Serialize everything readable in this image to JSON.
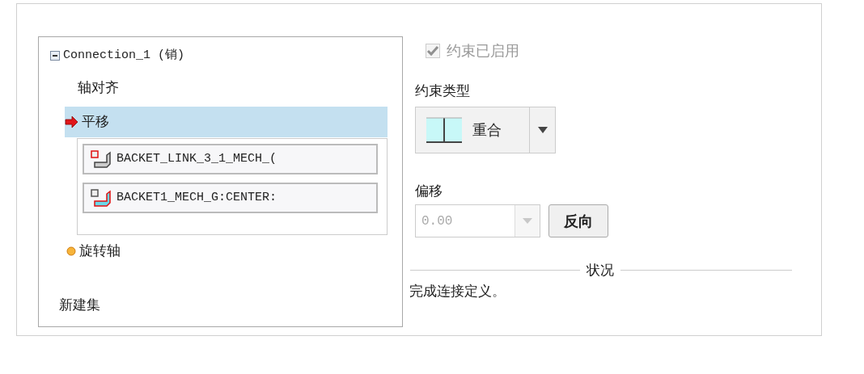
{
  "tree": {
    "label": "Connection_1 (销)",
    "expanded": true,
    "children": [
      {
        "label": "轴对齐",
        "kind": "plain",
        "selected": false
      },
      {
        "label": "平移",
        "kind": "current",
        "selected": true,
        "references": [
          "BACKET_LINK_3_1_MECH_(",
          "BACKET1_MECH_G:CENTER:"
        ]
      },
      {
        "label": "旋转轴",
        "kind": "incomplete",
        "selected": false
      }
    ],
    "new_set": "新建集"
  },
  "constraint_enabled": {
    "label": "约束已启用",
    "checked": true,
    "disabled": true
  },
  "constraint_type": {
    "label": "约束类型",
    "value": "重合"
  },
  "offset": {
    "label": "偏移",
    "value": "0.00",
    "disabled": true
  },
  "flip_button": "反向",
  "status": {
    "title": "状况",
    "message": "完成连接定义。"
  }
}
